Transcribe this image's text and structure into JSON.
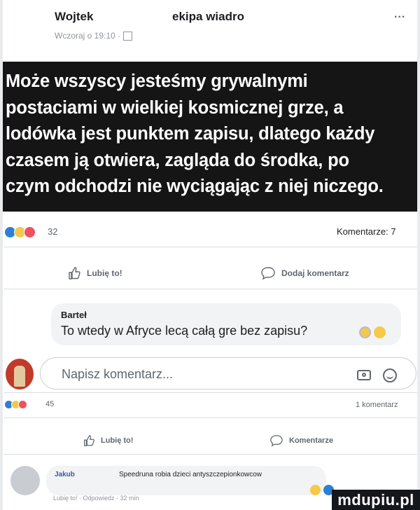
{
  "post": {
    "author": "Wojtek",
    "group": "ekipa wiadro",
    "more": "...",
    "timestamp": "Wczoraj o 19:10 ·",
    "text_lines": [
      "Może wszyscy jesteśmy grywalnymi",
      "postaciami w wielkiej kosmicznej grze, a",
      "lodówka jest punktem zapisu, dlatego każdy",
      "czasem ją otwiera, zagląda do środka, po",
      "czym odchodzi nie wyciągając z niej niczego."
    ],
    "reaction_count": "32",
    "comments_count": "Komentarze: 7",
    "like_label": "Lubię to!",
    "comment_label": "Dodaj komentarz"
  },
  "comment": {
    "name": "Barteł",
    "text": "To wtedy w Afryce lecą całą gre bez zapisu?"
  },
  "compose": {
    "placeholder": "Napisz komentarz..."
  },
  "post2": {
    "reaction_count": "45",
    "comments_count": "1 komentarz",
    "like_label": "Lubię to!",
    "comment_label": "Komentarze"
  },
  "comment2": {
    "name": "Jakub",
    "text": "Speedruna robia dzieci antyszczepionkowcow",
    "actions": "Lubię to! · Odpowiedz · 32 min"
  },
  "watermark": "mdupiu.pl",
  "colors": {
    "like_blue": "#2d7fd3",
    "wow_yellow": "#f2c94c",
    "love_red": "#f0505f",
    "post_bg": "#151515"
  }
}
